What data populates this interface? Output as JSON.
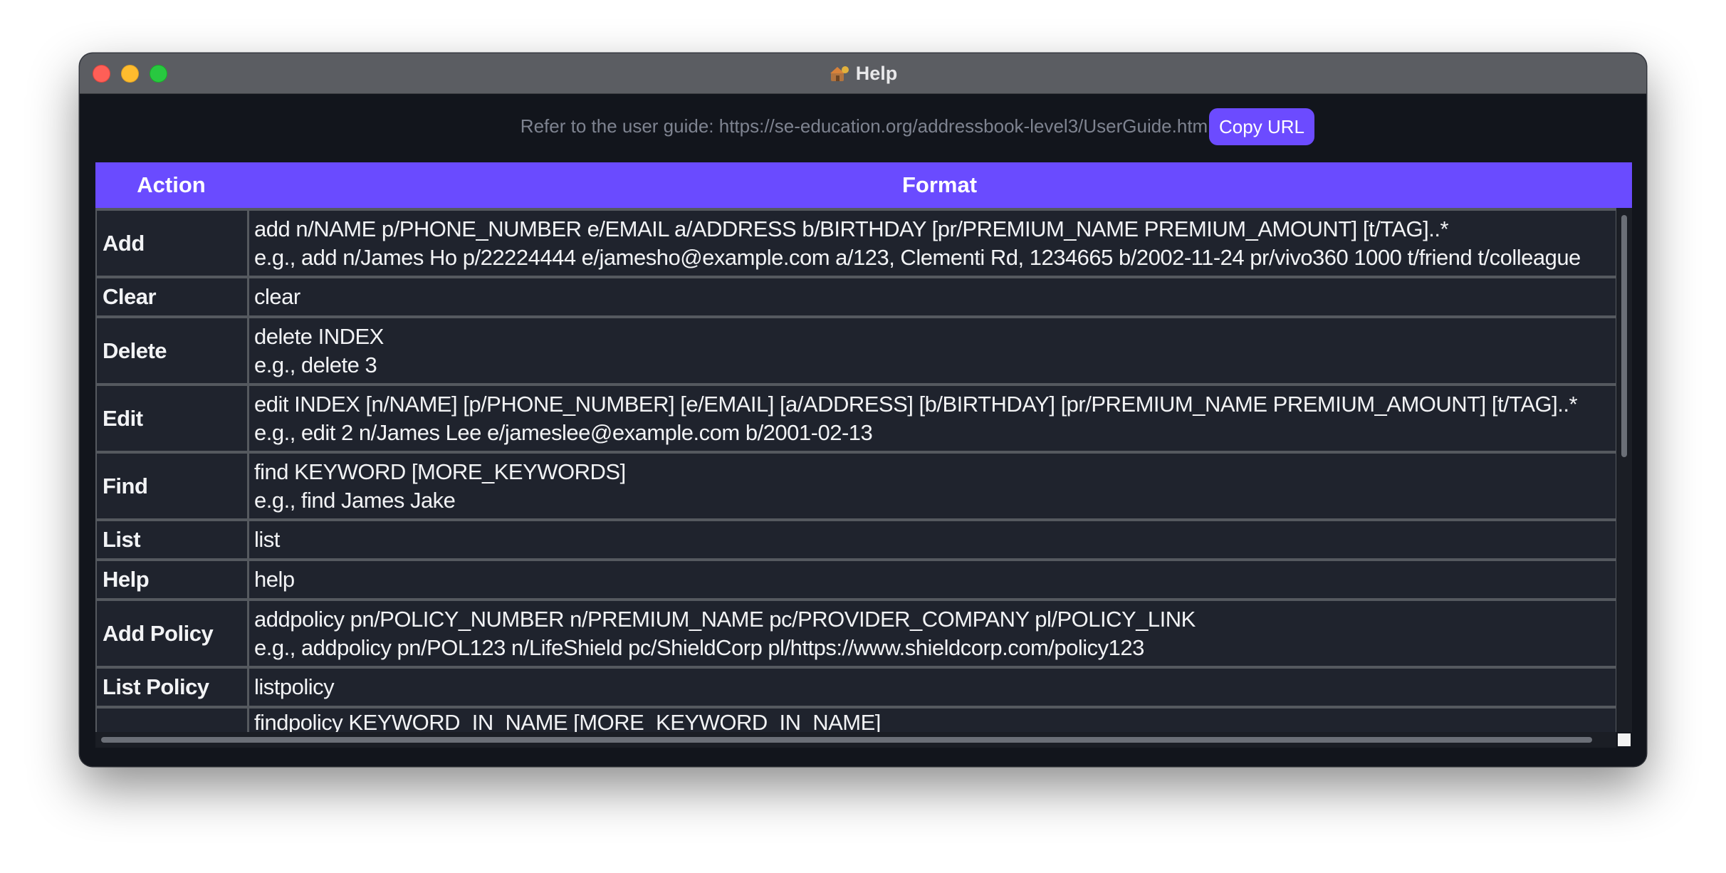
{
  "window": {
    "title": "Help"
  },
  "guide": {
    "text": "Refer to the user guide: https://se-education.org/addressbook-level3/UserGuide.html",
    "copy_button": "Copy URL"
  },
  "table": {
    "headers": {
      "action": "Action",
      "format": "Format"
    },
    "rows": [
      {
        "action": "Add",
        "format": [
          "add n/NAME p/PHONE_NUMBER e/EMAIL a/ADDRESS b/BIRTHDAY [pr/PREMIUM_NAME PREMIUM_AMOUNT] [t/TAG]..*",
          "e.g., add n/James Ho p/22224444 e/jamesho@example.com a/123, Clementi Rd, 1234665 b/2002-11-24 pr/vivo360 1000 t/friend t/colleague"
        ]
      },
      {
        "action": "Clear",
        "format": [
          "clear"
        ]
      },
      {
        "action": "Delete",
        "format": [
          "delete INDEX",
          "e.g., delete 3"
        ]
      },
      {
        "action": "Edit",
        "format": [
          "edit INDEX [n/NAME] [p/PHONE_NUMBER] [e/EMAIL] [a/ADDRESS] [b/BIRTHDAY] [pr/PREMIUM_NAME PREMIUM_AMOUNT] [t/TAG]..*",
          "e.g., edit 2 n/James Lee e/jameslee@example.com b/2001-02-13"
        ]
      },
      {
        "action": "Find",
        "format": [
          "find KEYWORD [MORE_KEYWORDS]",
          "e.g., find James Jake"
        ]
      },
      {
        "action": "List",
        "format": [
          "list"
        ]
      },
      {
        "action": "Help",
        "format": [
          "help"
        ]
      },
      {
        "action": "Add Policy",
        "format": [
          "addpolicy pn/POLICY_NUMBER n/PREMIUM_NAME pc/PROVIDER_COMPANY pl/POLICY_LINK",
          "e.g., addpolicy pn/POL123 n/LifeShield pc/ShieldCorp pl/https://www.shieldcorp.com/policy123"
        ]
      },
      {
        "action": "List Policy",
        "format": [
          "listpolicy"
        ]
      },
      {
        "action": "",
        "format": [
          "findpolicy KEYWORD_IN_NAME [MORE_KEYWORD_IN_NAME]"
        ]
      }
    ]
  }
}
